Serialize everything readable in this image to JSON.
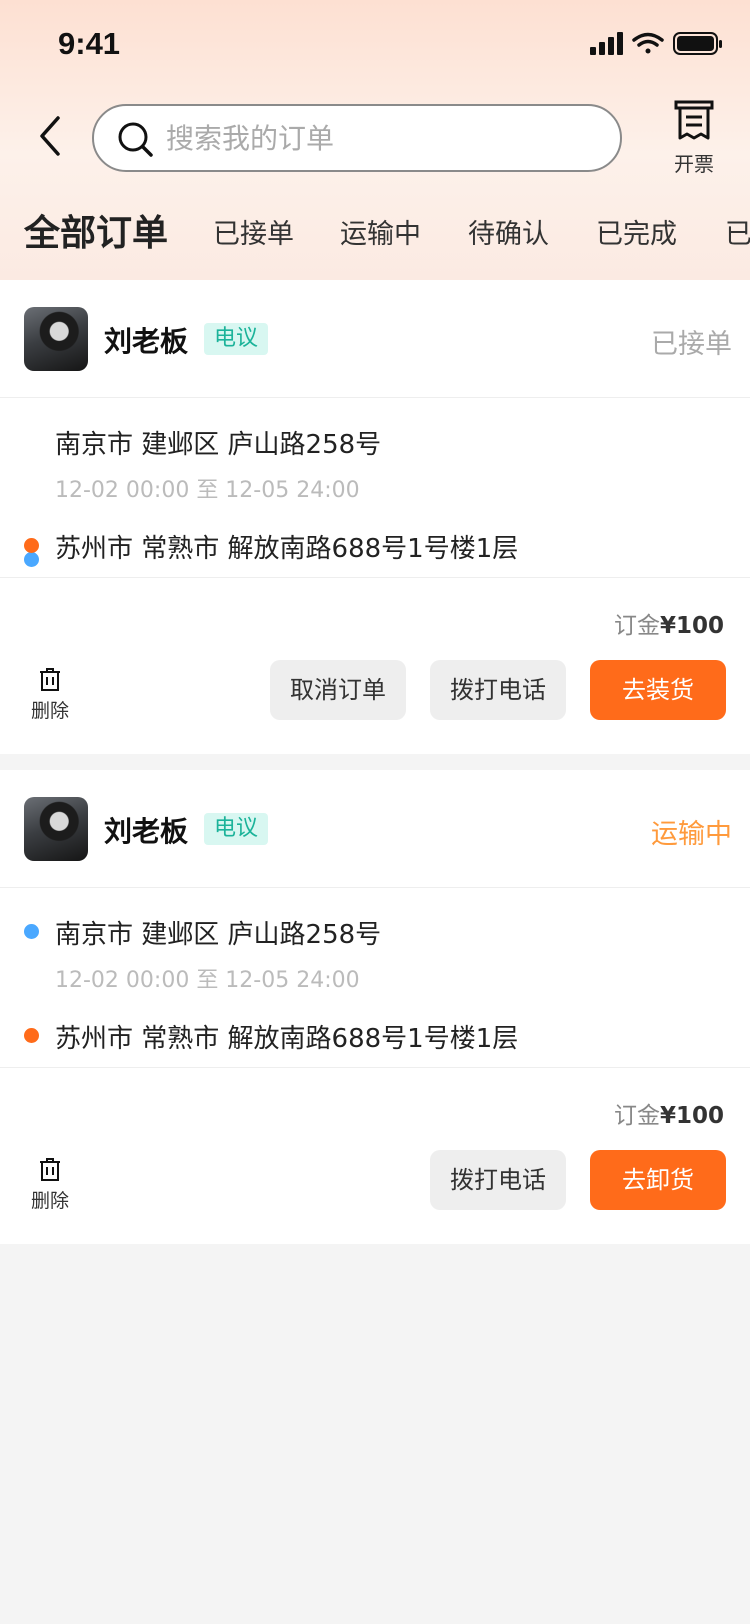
{
  "status_bar": {
    "time": "9:41"
  },
  "header": {
    "search_placeholder": "搜索我的订单",
    "invoice_label": "开票"
  },
  "tabs": [
    {
      "label": "全部订单",
      "active": true
    },
    {
      "label": "已接单"
    },
    {
      "label": "运输中"
    },
    {
      "label": "待确认"
    },
    {
      "label": "已完成"
    },
    {
      "label": "已"
    }
  ],
  "orders": [
    {
      "owner": "刘老板",
      "tag": "电议",
      "status": "已接单",
      "status_color": "#aaaaaa",
      "pickup_address": "南京市 建邺区 庐山路258号",
      "time_window": "12-02 00:00 至 12-05 24:00",
      "dropoff_address": "苏州市 常熟市 解放南路688号1号楼1层",
      "deposit_label": "订金",
      "deposit_amount": "¥100",
      "delete_label": "删除",
      "buttons": [
        "取消订单",
        "拨打电话",
        "去装货"
      ]
    },
    {
      "owner": "刘老板",
      "tag": "电议",
      "status": "运输中",
      "status_color": "#ff9a3c",
      "pickup_address": "南京市 建邺区 庐山路258号",
      "time_window": "12-02 00:00 至 12-05 24:00",
      "dropoff_address": "苏州市 常熟市 解放南路688号1号楼1层",
      "deposit_label": "订金",
      "deposit_amount": "¥100",
      "delete_label": "删除",
      "buttons": [
        "拨打电话",
        "去卸货"
      ]
    }
  ],
  "colors": {
    "accent": "#ff6b1a",
    "pickup_dot": "#4aa8ff",
    "dropoff_dot": "#ff6b1a",
    "tag_bg": "#d8f7f1",
    "tag_text": "#1bb39a"
  }
}
